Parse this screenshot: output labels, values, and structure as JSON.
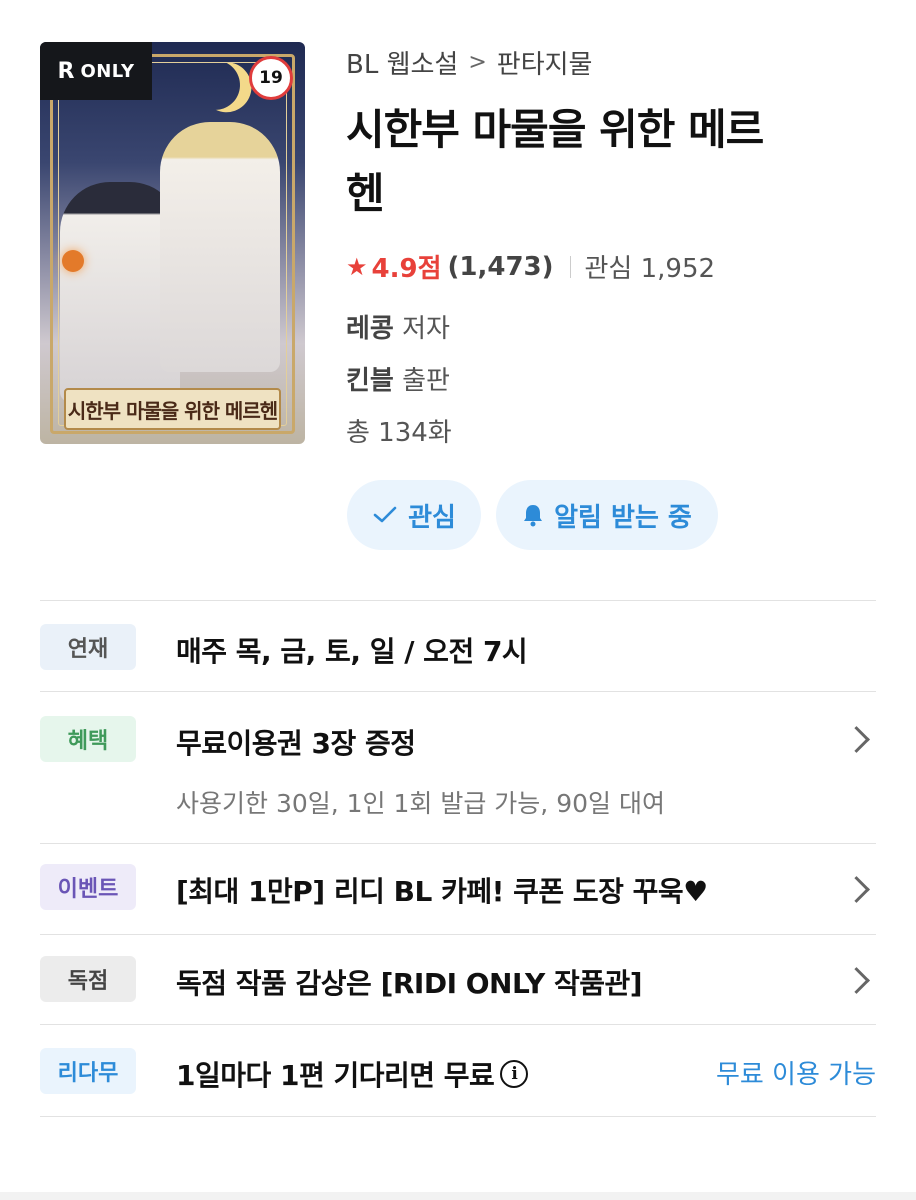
{
  "cover": {
    "badge_r": "R",
    "badge_only": "ONLY",
    "age_rating": "19",
    "cover_title": "시한부 마물을 위한 메르헨"
  },
  "breadcrumb": {
    "category": "BL 웹소설",
    "separator": ">",
    "genre": "판타지물"
  },
  "book": {
    "title_line1": "시한부 마물을 위한 메르",
    "title_line2": "헨",
    "rating_star": "★",
    "rating": "4.9점",
    "rating_count": "(1,473)",
    "favorites": "관심 1,952",
    "author_name": "레콩",
    "author_role": "저자",
    "publisher_name": "킨블",
    "publisher_role": "출판",
    "episodes": "총 134화"
  },
  "actions": {
    "favorite_label": "관심",
    "notify_label": "알림 받는 중"
  },
  "rows": [
    {
      "tag": "연재",
      "text": "매주 목, 금, 토, 일 / 오전 7시"
    },
    {
      "tag": "혜택",
      "text": "무료이용권 3장 증정",
      "sub": "사용기한 30일, 1인 1회 발급 가능, 90일 대여"
    },
    {
      "tag": "이벤트",
      "text": "[최대 1만P] 리디 BL 카페! 쿠폰 도장 꾸욱♥"
    },
    {
      "tag": "독점",
      "text": "독점 작품 감상은 [RIDI ONLY 작품관]"
    },
    {
      "tag": "리다무",
      "text": "1일마다 1편 기다리면 무료",
      "status": "무료 이용 가능"
    }
  ],
  "colors": {
    "accent_blue": "#2d8bd8",
    "rating_red": "#e8413a"
  }
}
